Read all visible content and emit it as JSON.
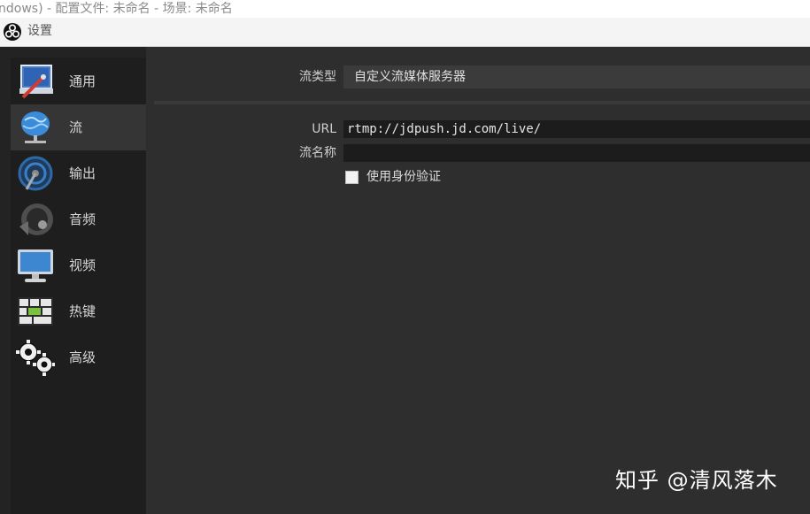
{
  "window": {
    "parent_title": "ndows) - 配置文件: 未命名 - 场景: 未命名",
    "dialog_title": "设置"
  },
  "sidebar": {
    "items": [
      {
        "label": "通用",
        "icon": "general-icon",
        "active": false
      },
      {
        "label": "流",
        "icon": "stream-globe-icon",
        "active": true
      },
      {
        "label": "输出",
        "icon": "output-icon",
        "active": false
      },
      {
        "label": "音频",
        "icon": "audio-speaker-icon",
        "active": false
      },
      {
        "label": "视频",
        "icon": "video-monitor-icon",
        "active": false
      },
      {
        "label": "热键",
        "icon": "hotkeys-keyboard-icon",
        "active": false
      },
      {
        "label": "高级",
        "icon": "advanced-gears-icon",
        "active": false
      }
    ]
  },
  "stream": {
    "type_label": "流类型",
    "type_value": "自定义流媒体服务器",
    "url_label": "URL",
    "url_value": "rtmp://jdpush.jd.com/live/",
    "key_label": "流名称",
    "key_value": "",
    "auth_label": "使用身份验证",
    "auth_checked": false
  },
  "watermark": "知乎 @清风落木"
}
